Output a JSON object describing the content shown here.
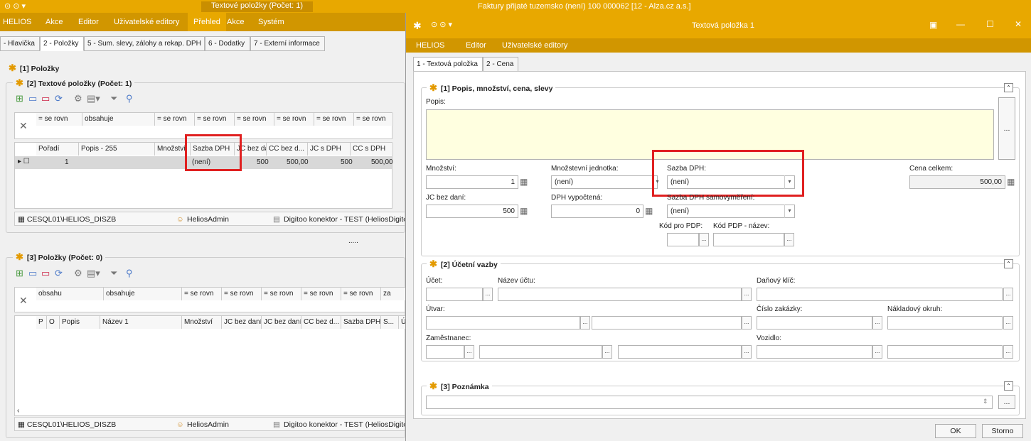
{
  "left_window": {
    "title": "Textové položky (Počet: 1)",
    "menu": [
      "HELIOS",
      "Akce",
      "Editor",
      "Uživatelské editory",
      "Přehled",
      "Akce",
      "Systém"
    ],
    "tabs": [
      "- Hlavička",
      "2 - Položky",
      "5 - Sum. slevy, zálohy a rekap. DPH",
      "6 - Dodatky",
      "7 - Externí informace"
    ],
    "group_polozky": "[1] Položky",
    "group_textove": "[2] Textové položky (Počet: 1)",
    "filter_ops": [
      "= se rovn",
      "obsahuje",
      "= se rovn",
      "= se rovn",
      "= se rovn",
      "= se rovn",
      "= se rovn",
      "= se rovn"
    ],
    "grid1_headers": [
      "Pořadí",
      "Popis - 255",
      "Množství",
      "Sazba DPH",
      "JC bez daní",
      "CC bez d...",
      "JC s DPH",
      "CC s DPH"
    ],
    "grid1_row": [
      "1",
      "",
      "",
      "(není)",
      "500",
      "500,00",
      "500",
      "500,00"
    ],
    "status1": [
      "CESQL01\\HELIOS_DISZB",
      "HeliosAdmin",
      "Digitoo konektor - TEST (HeliosDigitoo)"
    ],
    "dots": ".....",
    "group_polozky3": "[3] Položky (Počet: 0)",
    "filter_ops2": [
      "obsahu",
      "obsahuje",
      "= se rovn",
      "= se rovn",
      "= se rovn",
      "= se rovn",
      "= se rovn",
      "za"
    ],
    "grid2_headers": [
      "P",
      "O",
      "Popis",
      "Název 1",
      "Množství",
      "JC bez daní",
      "JC bez daní",
      "CC bez d...",
      "Sazba DPH",
      "S...",
      "Ú"
    ],
    "status2": [
      "CESQL01\\HELIOS_DISZB",
      "HeliosAdmin",
      "Digitoo konektor - TEST (HeliosDigitoo)"
    ]
  },
  "right_window": {
    "app_title": "Faktury přijaté tuzemsko (není)  100 000062 [12 - Alza.cz a.s.]",
    "title": "Textová položka 1",
    "menu": [
      "HELIOS",
      "Editor",
      "Uživatelské editory"
    ],
    "tabs": [
      "1 - Textová položka",
      "2 - Cena"
    ],
    "group1": "[1] Popis, množství, cena, slevy",
    "popis_label": "Popis:",
    "mnozstvi_label": "Množství:",
    "mnozstvi_value": "1",
    "jednotka_label": "Množstevní jednotka:",
    "jednotka_value": "(není)",
    "sazba_label": "Sazba DPH:",
    "sazba_value": "(není)",
    "cena_label": "Cena celkem:",
    "cena_value": "500,00",
    "jc_label": "JC bez daní:",
    "jc_value": "500",
    "dph_label": "DPH vypočtená:",
    "dph_value": "0",
    "sazba_sam_label": "Sazba DPH samovyměření:",
    "sazba_sam_value": "(není)",
    "kod_pdp_label": "Kód pro PDP:",
    "kod_pdp_nazev_label": "Kód PDP - název:",
    "group2": "[2] Účetní vazby",
    "ucet_label": "Účet:",
    "nazev_uctu_label": "Název účtu:",
    "danovy_klic_label": "Daňový klíč:",
    "utvar_label": "Útvar:",
    "cislo_zakazky_label": "Číslo zakázky:",
    "nakladovy_okruh_label": "Nákladový okruh:",
    "zamestnanec_label": "Zaměstnanec:",
    "vozidlo_label": "Vozidlo:",
    "group3": "[3] Poznámka",
    "ok_label": "OK",
    "storno_label": "Storno",
    "ellipsis": "..."
  },
  "colors": {
    "accent": "#e8a800",
    "menu": "#d19600",
    "highlight": "#e02020",
    "yellow_field": "#ffffe0"
  }
}
